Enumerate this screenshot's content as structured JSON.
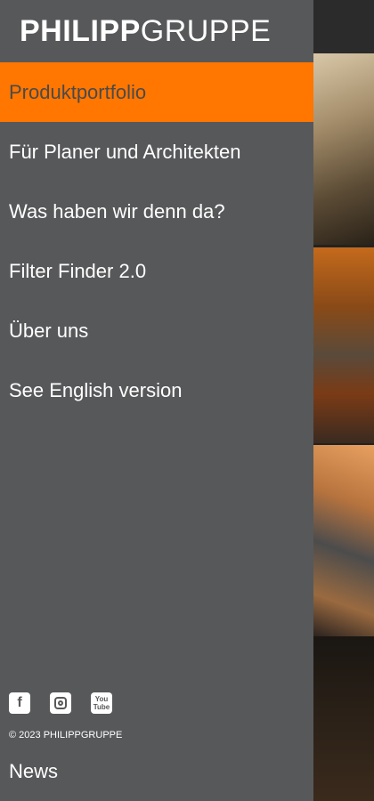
{
  "brand": {
    "logo_bold": "PHILIPP",
    "logo_light": "GRUPPE"
  },
  "menu": {
    "items": [
      {
        "label": "Produktportfolio",
        "active": true
      },
      {
        "label": "Für Planer und Architekten"
      },
      {
        "label": "Was haben wir denn da?"
      },
      {
        "label": "Filter Finder 2.0"
      },
      {
        "label": "Über uns"
      },
      {
        "label": "See English version"
      }
    ]
  },
  "social": {
    "facebook": "f",
    "youtube_top": "You",
    "youtube_bottom": "Tube"
  },
  "footer": {
    "copyright": "© 2023 PHILIPPGRUPPE",
    "news": "News"
  },
  "colors": {
    "accent": "#ff7600",
    "drawer_bg": "#57585a"
  }
}
